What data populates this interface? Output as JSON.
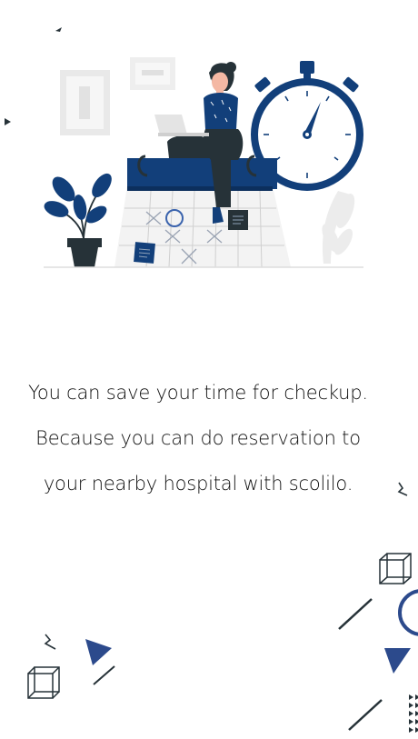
{
  "onboarding": {
    "illustration_icon": "person-calendar-stopwatch-illustration",
    "message_lines": [
      "You can save your time for checkup.",
      "Because you can do reservation to",
      "your nearby hospital with scolilo."
    ]
  },
  "colors": {
    "primary": "#123f7a",
    "accent": "#2c4a8c",
    "light_gray": "#e6e6e6",
    "text": "#111111"
  }
}
